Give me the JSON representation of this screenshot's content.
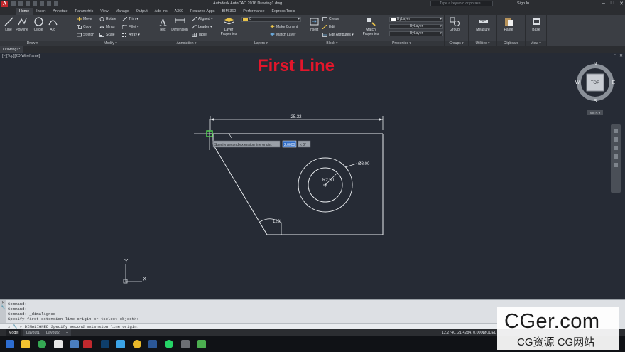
{
  "app": {
    "title": "Autodesk AutoCAD 2016    Drawing1.dwg",
    "search_placeholder": "Type a keyword or phrase",
    "signin": "Sign In"
  },
  "ribbon_tabs": [
    "Home",
    "Insert",
    "Annotate",
    "Parametric",
    "View",
    "Manage",
    "Output",
    "Add-ins",
    "A360",
    "Featured Apps",
    "BIM 360",
    "Performance",
    "Express Tools"
  ],
  "ribbon": {
    "draw": {
      "title": "Draw ▾",
      "line": "Line",
      "polyline": "Polyline",
      "circle": "Circle",
      "arc": "Arc"
    },
    "modify": {
      "title": "Modify ▾",
      "move": "Move",
      "rotate": "Rotate",
      "trim": "Trim ▾",
      "copy": "Copy",
      "mirror": "Mirror",
      "fillet": "Fillet ▾",
      "stretch": "Stretch",
      "scale": "Scale",
      "array": "Array ▾"
    },
    "annotation": {
      "title": "Annotation ▾",
      "text": "Text",
      "dimension": "Dimension",
      "aligned": "Aligned ▾",
      "leader": "Leader ▾",
      "table": "Table"
    },
    "layers": {
      "title": "Layers ▾",
      "layer_properties": "Layer\nProperties",
      "make_current": "Make Current",
      "match_layer": "Match Layer",
      "layer_value": "0"
    },
    "block": {
      "title": "Block ▾",
      "insert": "Insert",
      "create": "Create",
      "edit": "Edit",
      "edit_attributes": "Edit Attributes ▾"
    },
    "properties": {
      "title": "Properties ▾",
      "match": "Match\nProperties",
      "bylayer1": "ByLayer",
      "bylayer2": "ByLayer",
      "bylayer3": "ByLayer"
    },
    "groups": {
      "title": "Groups ▾",
      "group": "Group"
    },
    "utilities": {
      "title": "Utilities ▾",
      "measure": "Measure"
    },
    "clipboard": {
      "title": "Clipboard",
      "paste": "Paste"
    },
    "view": {
      "title": "View ▾",
      "base": "Base"
    }
  },
  "file_tab": "Drawing1*",
  "viewport": {
    "label": "[−][Top][2D Wireframe]",
    "heading": "First Line",
    "heading_color": "#e3162b",
    "dim_width": "25.32",
    "dim_diameter": "Ø8.00",
    "dim_radius": "R2.50",
    "dim_angle": "120°",
    "tooltip": "Specify second extension line origin:",
    "tooltip_value": "2.0000",
    "tooltip_angle": "< 0°",
    "viewcube": {
      "n": "N",
      "s": "S",
      "e": "E",
      "w": "W",
      "face": "TOP",
      "wcs": "WCS ▾"
    },
    "ucs": {
      "x": "X",
      "y": "Y"
    }
  },
  "command": {
    "history": [
      "Command:",
      "Command:",
      "Command: _dimaligned",
      "Specify first extension line origin or <select object>:"
    ],
    "prompt_prefix": "✕ 🔧 ▸",
    "prompt": "DIMALIGNED Specify second extension line origin:"
  },
  "layout_tabs": [
    "Model",
    "Layout1",
    "Layout2",
    "+"
  ],
  "status": {
    "coords": "12.2740, 21.4284, 0.0000",
    "model": "MODEL"
  },
  "watermark": {
    "big": "CGer.com",
    "small": "CG资源  CG网站"
  },
  "colors": {
    "canvas": "#262b35",
    "ribbon": "#3b3e44",
    "accent": "#c0282d",
    "osnap": "#52d152"
  }
}
